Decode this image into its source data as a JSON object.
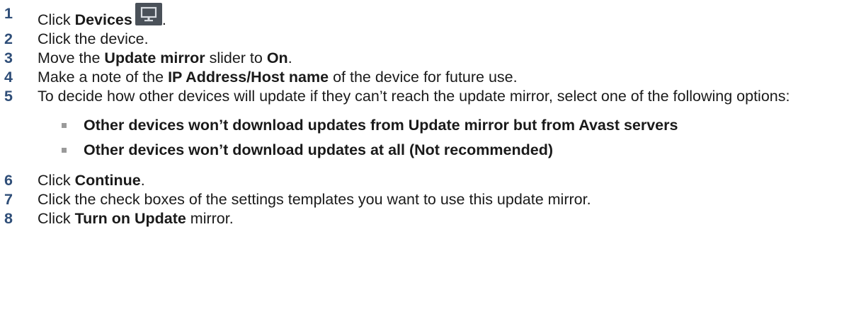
{
  "steps": [
    {
      "num": "1",
      "pre": "Click ",
      "bold": "Devices",
      "post": "."
    },
    {
      "num": "2",
      "text": "Click the device."
    },
    {
      "num": "3",
      "pre": "Move the ",
      "bold": "Update mirror",
      "mid": " slider to ",
      "bold2": "On",
      "post": "."
    },
    {
      "num": "4",
      "pre": "Make a note of the ",
      "bold": "IP Address/Host name",
      "post": " of the device for future use."
    },
    {
      "num": "5",
      "text": "To decide how other devices will update if they can’t reach the update mirror, select one of the following options:"
    },
    {
      "num": "6",
      "pre": "Click ",
      "bold": "Continue",
      "post": "."
    },
    {
      "num": "7",
      "text": "Click the check boxes of the settings templates you want to use this update mirror."
    },
    {
      "num": "8",
      "pre": "Click ",
      "bold": "Turn on Update",
      "post": " mirror."
    }
  ],
  "options": [
    "Other devices won’t download updates from Update mirror but from Avast servers",
    "Other devices won’t download updates at all (Not recommended)"
  ],
  "icons": {
    "devices": "monitor-icon"
  },
  "colors": {
    "step_number": "#2f4e78",
    "icon_bg": "#4a5159",
    "icon_fg": "#d9dde2",
    "bullet": "#9a9a9a"
  }
}
